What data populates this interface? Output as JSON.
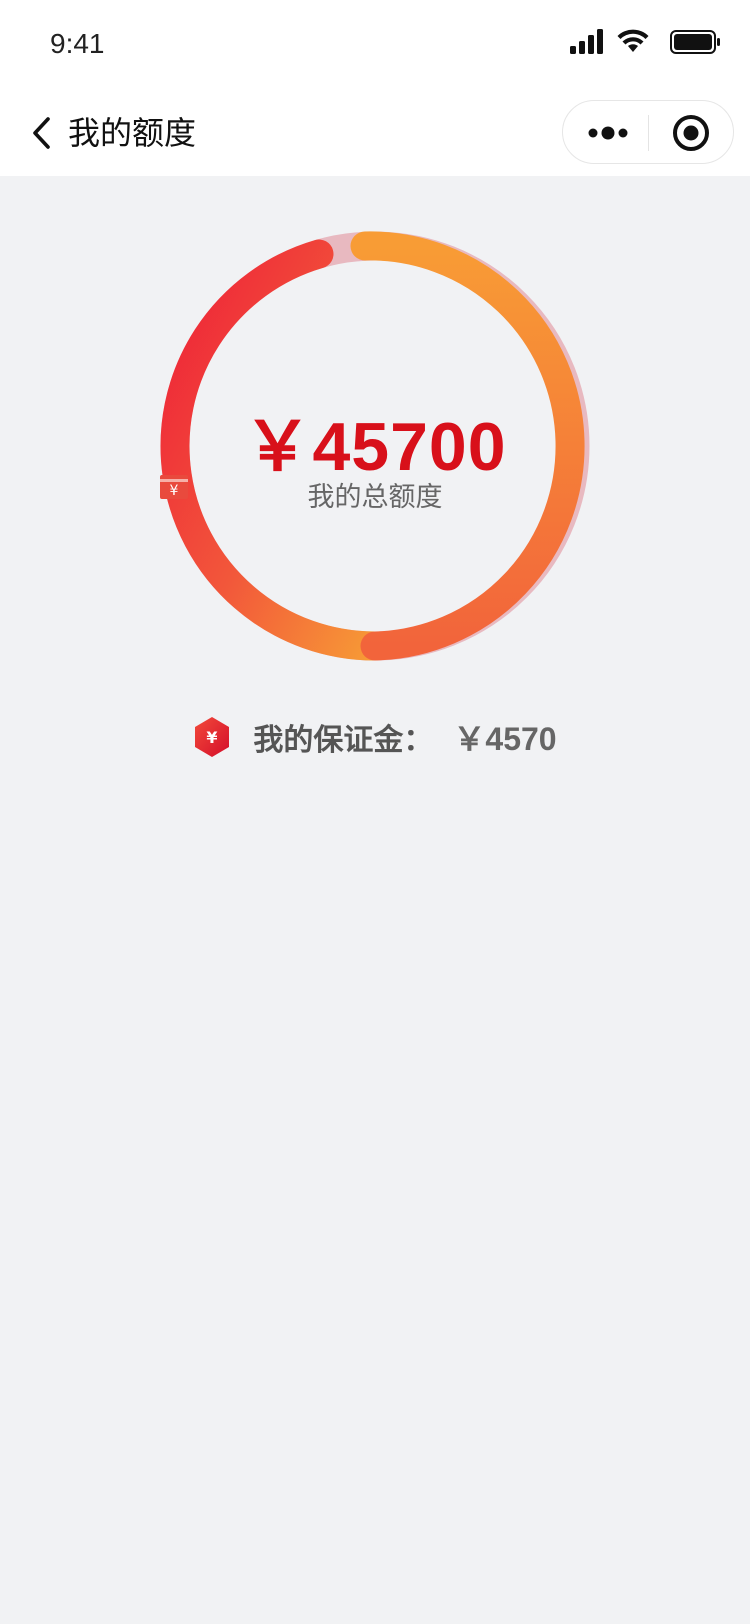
{
  "status_bar": {
    "time": "9:41",
    "icons": [
      "signal-icon",
      "wifi-icon",
      "battery-icon"
    ]
  },
  "nav": {
    "title": "我的额度",
    "back_icon": "chevron-left-icon",
    "more_icon": "more-dots-icon",
    "close_icon": "record-close-icon"
  },
  "total_limit": {
    "amount": "￥45700",
    "caption": "我的总额度",
    "caption_icon": "yuan-card-icon"
  },
  "deposit": {
    "label": "我的保证金：",
    "value": "￥4570",
    "icon": "yuan-hexagon-icon"
  },
  "colors": {
    "accent_red": "#d8101a",
    "ring_start": "#ee2a3c",
    "ring_end": "#f79a36",
    "ring_track": "#e8b9c0",
    "background": "#f1f2f4"
  }
}
